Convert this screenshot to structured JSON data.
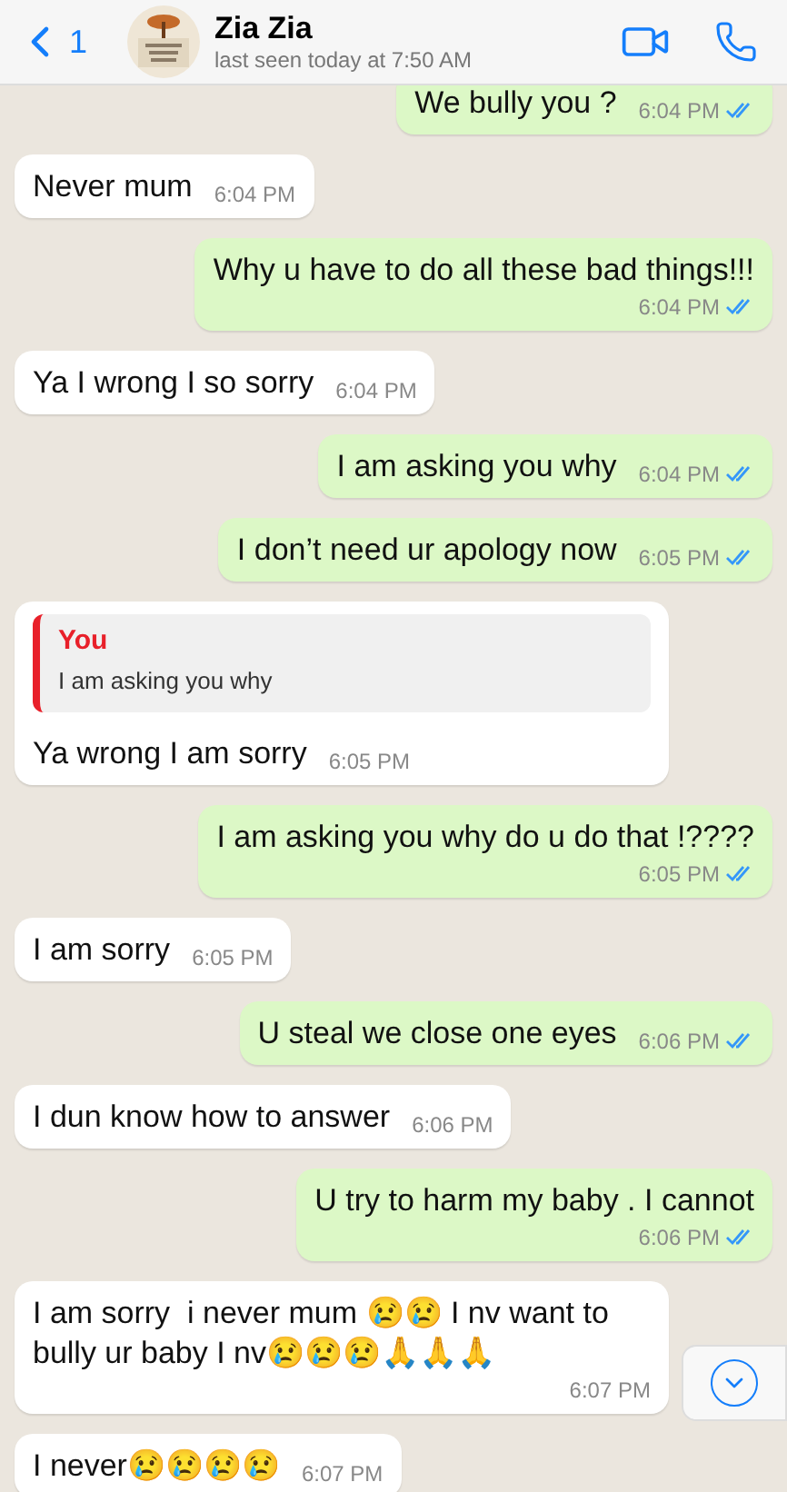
{
  "header": {
    "back_count": "1",
    "contact_name": "Zia Zia",
    "status": "last seen today at 7:50 AM"
  },
  "messages": [
    {
      "kind": "sent",
      "text": "We bully you ?",
      "time": "6:04 PM",
      "read": true,
      "time_below": false
    },
    {
      "kind": "received",
      "text": "Never mum",
      "time": "6:04 PM",
      "time_below": false
    },
    {
      "kind": "sent",
      "text": "Why u have to do all these bad things!!!",
      "time": "6:04 PM",
      "read": true,
      "time_below": true
    },
    {
      "kind": "received",
      "text": "Ya I wrong I so sorry",
      "time": "6:04 PM",
      "time_below": false
    },
    {
      "kind": "sent",
      "text": "I am asking you why",
      "time": "6:04 PM",
      "read": true,
      "time_below": false
    },
    {
      "kind": "sent",
      "text": "I don’t need ur apology now",
      "time": "6:05 PM",
      "read": true,
      "time_below": false
    },
    {
      "kind": "received",
      "quote": {
        "author": "You",
        "text": "I am asking you why"
      },
      "text": "Ya wrong I am sorry",
      "time": "6:05 PM",
      "time_below": false
    },
    {
      "kind": "sent",
      "text": "I am asking you why do u do that !????",
      "time": "6:05 PM",
      "read": true,
      "time_below": true
    },
    {
      "kind": "received",
      "text": "I am sorry",
      "time": "6:05 PM",
      "time_below": false
    },
    {
      "kind": "sent",
      "text": "U steal we close one eyes",
      "time": "6:06 PM",
      "read": true,
      "time_below": false
    },
    {
      "kind": "received",
      "text": "I dun know how to answer",
      "time": "6:06 PM",
      "time_below": false
    },
    {
      "kind": "sent",
      "text": "U try to harm my baby . I cannot",
      "time": "6:06 PM",
      "read": true,
      "time_below": true
    },
    {
      "kind": "received",
      "text": "I am sorry  i never mum 😢😢 I nv want to bully ur baby I nv😢😢😢🙏🙏🙏",
      "time": "6:07 PM",
      "time_below": true
    },
    {
      "kind": "received",
      "text": "I never😢😢😢😢",
      "time": "6:07 PM",
      "time_below": false
    }
  ]
}
